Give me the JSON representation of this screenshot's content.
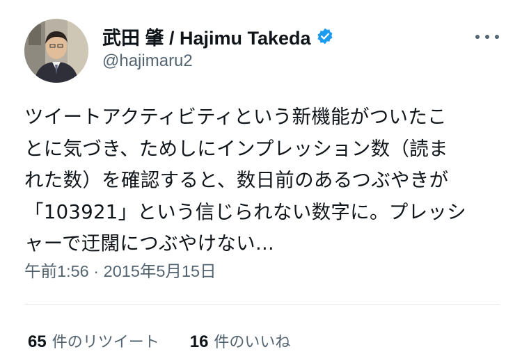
{
  "author": {
    "display_name": "武田 肇 / Hajimu Takeda",
    "handle": "@hajimaru2",
    "verified_icon": "verified-badge-icon",
    "badge_color": "#1d9bf0"
  },
  "menu_icon": "more-options-icon",
  "tweet": {
    "lines": [
      "ツイートアクティビティという新機能がついたこ",
      "とに気づき、ためしにインプレッション数（読ま",
      "れた数）を確認すると、数日前のあるつぶやきが",
      "「103921」という信じられない数字に。プレッシ",
      "ャーで迂闊につぶやけない..."
    ]
  },
  "timestamp": "午前1:56 · 2015年5月15日",
  "stats": {
    "retweets": {
      "count": "65",
      "label": "件のリツイート"
    },
    "likes": {
      "count": "16",
      "label": "件のいいね"
    }
  },
  "colors": {
    "text": "#0f1419",
    "secondary": "#536471",
    "divider": "#e7e9ea"
  }
}
